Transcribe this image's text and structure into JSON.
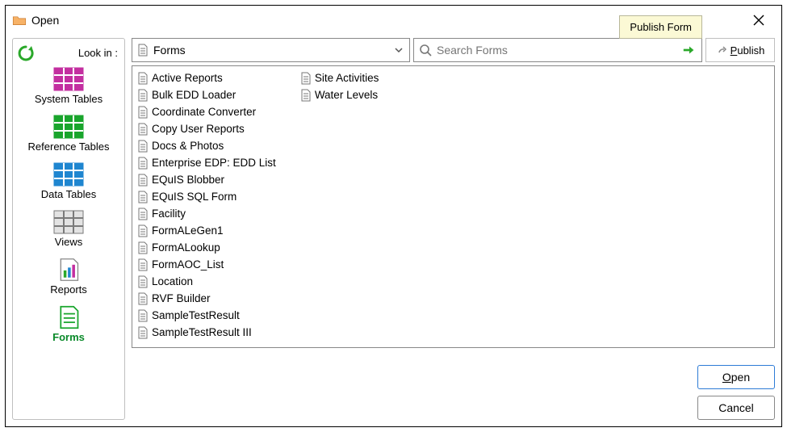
{
  "window": {
    "title": "Open"
  },
  "tooltip": {
    "publish": "Publish Form"
  },
  "sidebar": {
    "lookin_label": "Look in :",
    "items": [
      {
        "label": "System Tables",
        "color": "#c32fa0",
        "kind": "table",
        "active": false
      },
      {
        "label": "Reference Tables",
        "color": "#19a52c",
        "kind": "table",
        "active": false
      },
      {
        "label": "Data Tables",
        "color": "#1f86d0",
        "kind": "table",
        "active": false
      },
      {
        "label": "Views",
        "color": "#9f9f9f",
        "kind": "views",
        "active": false
      },
      {
        "label": "Reports",
        "color": "#19a52c",
        "kind": "reports",
        "active": false
      },
      {
        "label": "Forms",
        "color": "#19a52c",
        "kind": "forms",
        "active": true
      }
    ]
  },
  "toolbar": {
    "combo_value": "Forms",
    "search_placeholder": "Search Forms",
    "publish_label": "Publish"
  },
  "files": [
    "Active Reports",
    "Bulk EDD Loader",
    "Coordinate Converter",
    "Copy User Reports",
    "Docs & Photos",
    "Enterprise EDP: EDD List",
    "EQuIS Blobber",
    "EQuIS SQL Form",
    "Facility",
    "FormALeGen1",
    "FormALookup",
    "FormAOC_List",
    "Location",
    "RVF Builder",
    "SampleTestResult",
    "SampleTestResult III",
    "Site Activities",
    "Water Levels"
  ],
  "buttons": {
    "open": "Open",
    "cancel": "Cancel"
  }
}
